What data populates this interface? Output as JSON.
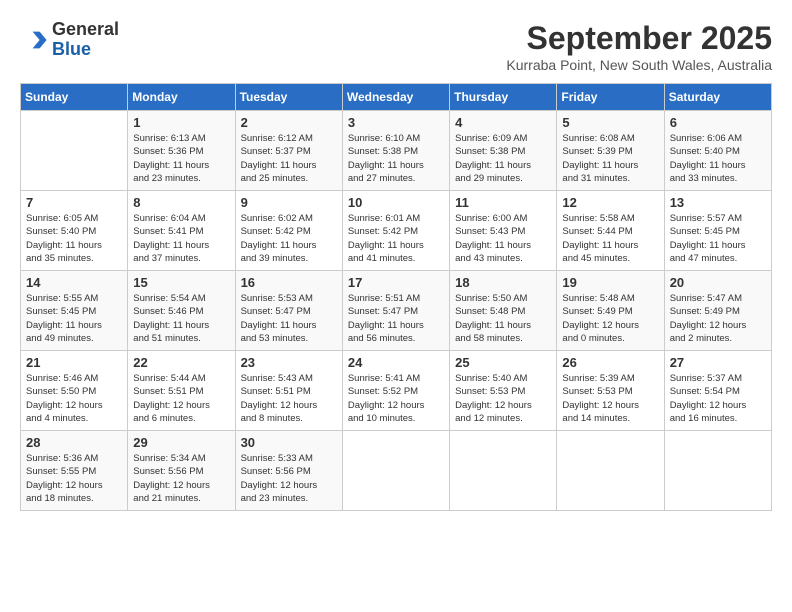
{
  "header": {
    "logo_general": "General",
    "logo_blue": "Blue",
    "month": "September 2025",
    "location": "Kurraba Point, New South Wales, Australia"
  },
  "days_of_week": [
    "Sunday",
    "Monday",
    "Tuesday",
    "Wednesday",
    "Thursday",
    "Friday",
    "Saturday"
  ],
  "weeks": [
    [
      {
        "day": "",
        "info": ""
      },
      {
        "day": "1",
        "info": "Sunrise: 6:13 AM\nSunset: 5:36 PM\nDaylight: 11 hours\nand 23 minutes."
      },
      {
        "day": "2",
        "info": "Sunrise: 6:12 AM\nSunset: 5:37 PM\nDaylight: 11 hours\nand 25 minutes."
      },
      {
        "day": "3",
        "info": "Sunrise: 6:10 AM\nSunset: 5:38 PM\nDaylight: 11 hours\nand 27 minutes."
      },
      {
        "day": "4",
        "info": "Sunrise: 6:09 AM\nSunset: 5:38 PM\nDaylight: 11 hours\nand 29 minutes."
      },
      {
        "day": "5",
        "info": "Sunrise: 6:08 AM\nSunset: 5:39 PM\nDaylight: 11 hours\nand 31 minutes."
      },
      {
        "day": "6",
        "info": "Sunrise: 6:06 AM\nSunset: 5:40 PM\nDaylight: 11 hours\nand 33 minutes."
      }
    ],
    [
      {
        "day": "7",
        "info": "Sunrise: 6:05 AM\nSunset: 5:40 PM\nDaylight: 11 hours\nand 35 minutes."
      },
      {
        "day": "8",
        "info": "Sunrise: 6:04 AM\nSunset: 5:41 PM\nDaylight: 11 hours\nand 37 minutes."
      },
      {
        "day": "9",
        "info": "Sunrise: 6:02 AM\nSunset: 5:42 PM\nDaylight: 11 hours\nand 39 minutes."
      },
      {
        "day": "10",
        "info": "Sunrise: 6:01 AM\nSunset: 5:42 PM\nDaylight: 11 hours\nand 41 minutes."
      },
      {
        "day": "11",
        "info": "Sunrise: 6:00 AM\nSunset: 5:43 PM\nDaylight: 11 hours\nand 43 minutes."
      },
      {
        "day": "12",
        "info": "Sunrise: 5:58 AM\nSunset: 5:44 PM\nDaylight: 11 hours\nand 45 minutes."
      },
      {
        "day": "13",
        "info": "Sunrise: 5:57 AM\nSunset: 5:45 PM\nDaylight: 11 hours\nand 47 minutes."
      }
    ],
    [
      {
        "day": "14",
        "info": "Sunrise: 5:55 AM\nSunset: 5:45 PM\nDaylight: 11 hours\nand 49 minutes."
      },
      {
        "day": "15",
        "info": "Sunrise: 5:54 AM\nSunset: 5:46 PM\nDaylight: 11 hours\nand 51 minutes."
      },
      {
        "day": "16",
        "info": "Sunrise: 5:53 AM\nSunset: 5:47 PM\nDaylight: 11 hours\nand 53 minutes."
      },
      {
        "day": "17",
        "info": "Sunrise: 5:51 AM\nSunset: 5:47 PM\nDaylight: 11 hours\nand 56 minutes."
      },
      {
        "day": "18",
        "info": "Sunrise: 5:50 AM\nSunset: 5:48 PM\nDaylight: 11 hours\nand 58 minutes."
      },
      {
        "day": "19",
        "info": "Sunrise: 5:48 AM\nSunset: 5:49 PM\nDaylight: 12 hours\nand 0 minutes."
      },
      {
        "day": "20",
        "info": "Sunrise: 5:47 AM\nSunset: 5:49 PM\nDaylight: 12 hours\nand 2 minutes."
      }
    ],
    [
      {
        "day": "21",
        "info": "Sunrise: 5:46 AM\nSunset: 5:50 PM\nDaylight: 12 hours\nand 4 minutes."
      },
      {
        "day": "22",
        "info": "Sunrise: 5:44 AM\nSunset: 5:51 PM\nDaylight: 12 hours\nand 6 minutes."
      },
      {
        "day": "23",
        "info": "Sunrise: 5:43 AM\nSunset: 5:51 PM\nDaylight: 12 hours\nand 8 minutes."
      },
      {
        "day": "24",
        "info": "Sunrise: 5:41 AM\nSunset: 5:52 PM\nDaylight: 12 hours\nand 10 minutes."
      },
      {
        "day": "25",
        "info": "Sunrise: 5:40 AM\nSunset: 5:53 PM\nDaylight: 12 hours\nand 12 minutes."
      },
      {
        "day": "26",
        "info": "Sunrise: 5:39 AM\nSunset: 5:53 PM\nDaylight: 12 hours\nand 14 minutes."
      },
      {
        "day": "27",
        "info": "Sunrise: 5:37 AM\nSunset: 5:54 PM\nDaylight: 12 hours\nand 16 minutes."
      }
    ],
    [
      {
        "day": "28",
        "info": "Sunrise: 5:36 AM\nSunset: 5:55 PM\nDaylight: 12 hours\nand 18 minutes."
      },
      {
        "day": "29",
        "info": "Sunrise: 5:34 AM\nSunset: 5:56 PM\nDaylight: 12 hours\nand 21 minutes."
      },
      {
        "day": "30",
        "info": "Sunrise: 5:33 AM\nSunset: 5:56 PM\nDaylight: 12 hours\nand 23 minutes."
      },
      {
        "day": "",
        "info": ""
      },
      {
        "day": "",
        "info": ""
      },
      {
        "day": "",
        "info": ""
      },
      {
        "day": "",
        "info": ""
      }
    ]
  ]
}
